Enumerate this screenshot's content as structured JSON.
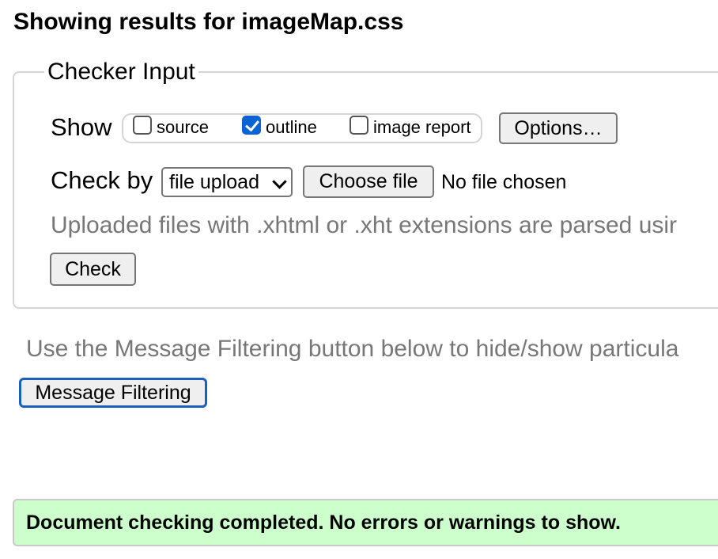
{
  "header": {
    "title": "Showing results for imageMap.css"
  },
  "checker_input": {
    "legend": "Checker Input",
    "show_label": "Show",
    "options": [
      {
        "label": "source",
        "checked": false
      },
      {
        "label": "outline",
        "checked": true
      },
      {
        "label": "image report",
        "checked": false
      }
    ],
    "options_button": "Options…",
    "check_by_label": "Check by",
    "check_by_value": "file upload",
    "choose_file_button": "Choose file",
    "file_status": "No file chosen",
    "note": "Uploaded files with .xhtml or .xht extensions are parsed usir",
    "check_button": "Check"
  },
  "filter": {
    "text": "Use the Message Filtering button below to hide/show particula",
    "button": "Message Filtering"
  },
  "result": {
    "message": "Document checking completed. No errors or warnings to show.",
    "background_color": "#ccffcc"
  },
  "colors": {
    "checkbox_checked": "#0a63d4",
    "focus_ring": "#1d5fb8",
    "muted_text": "#777777"
  }
}
